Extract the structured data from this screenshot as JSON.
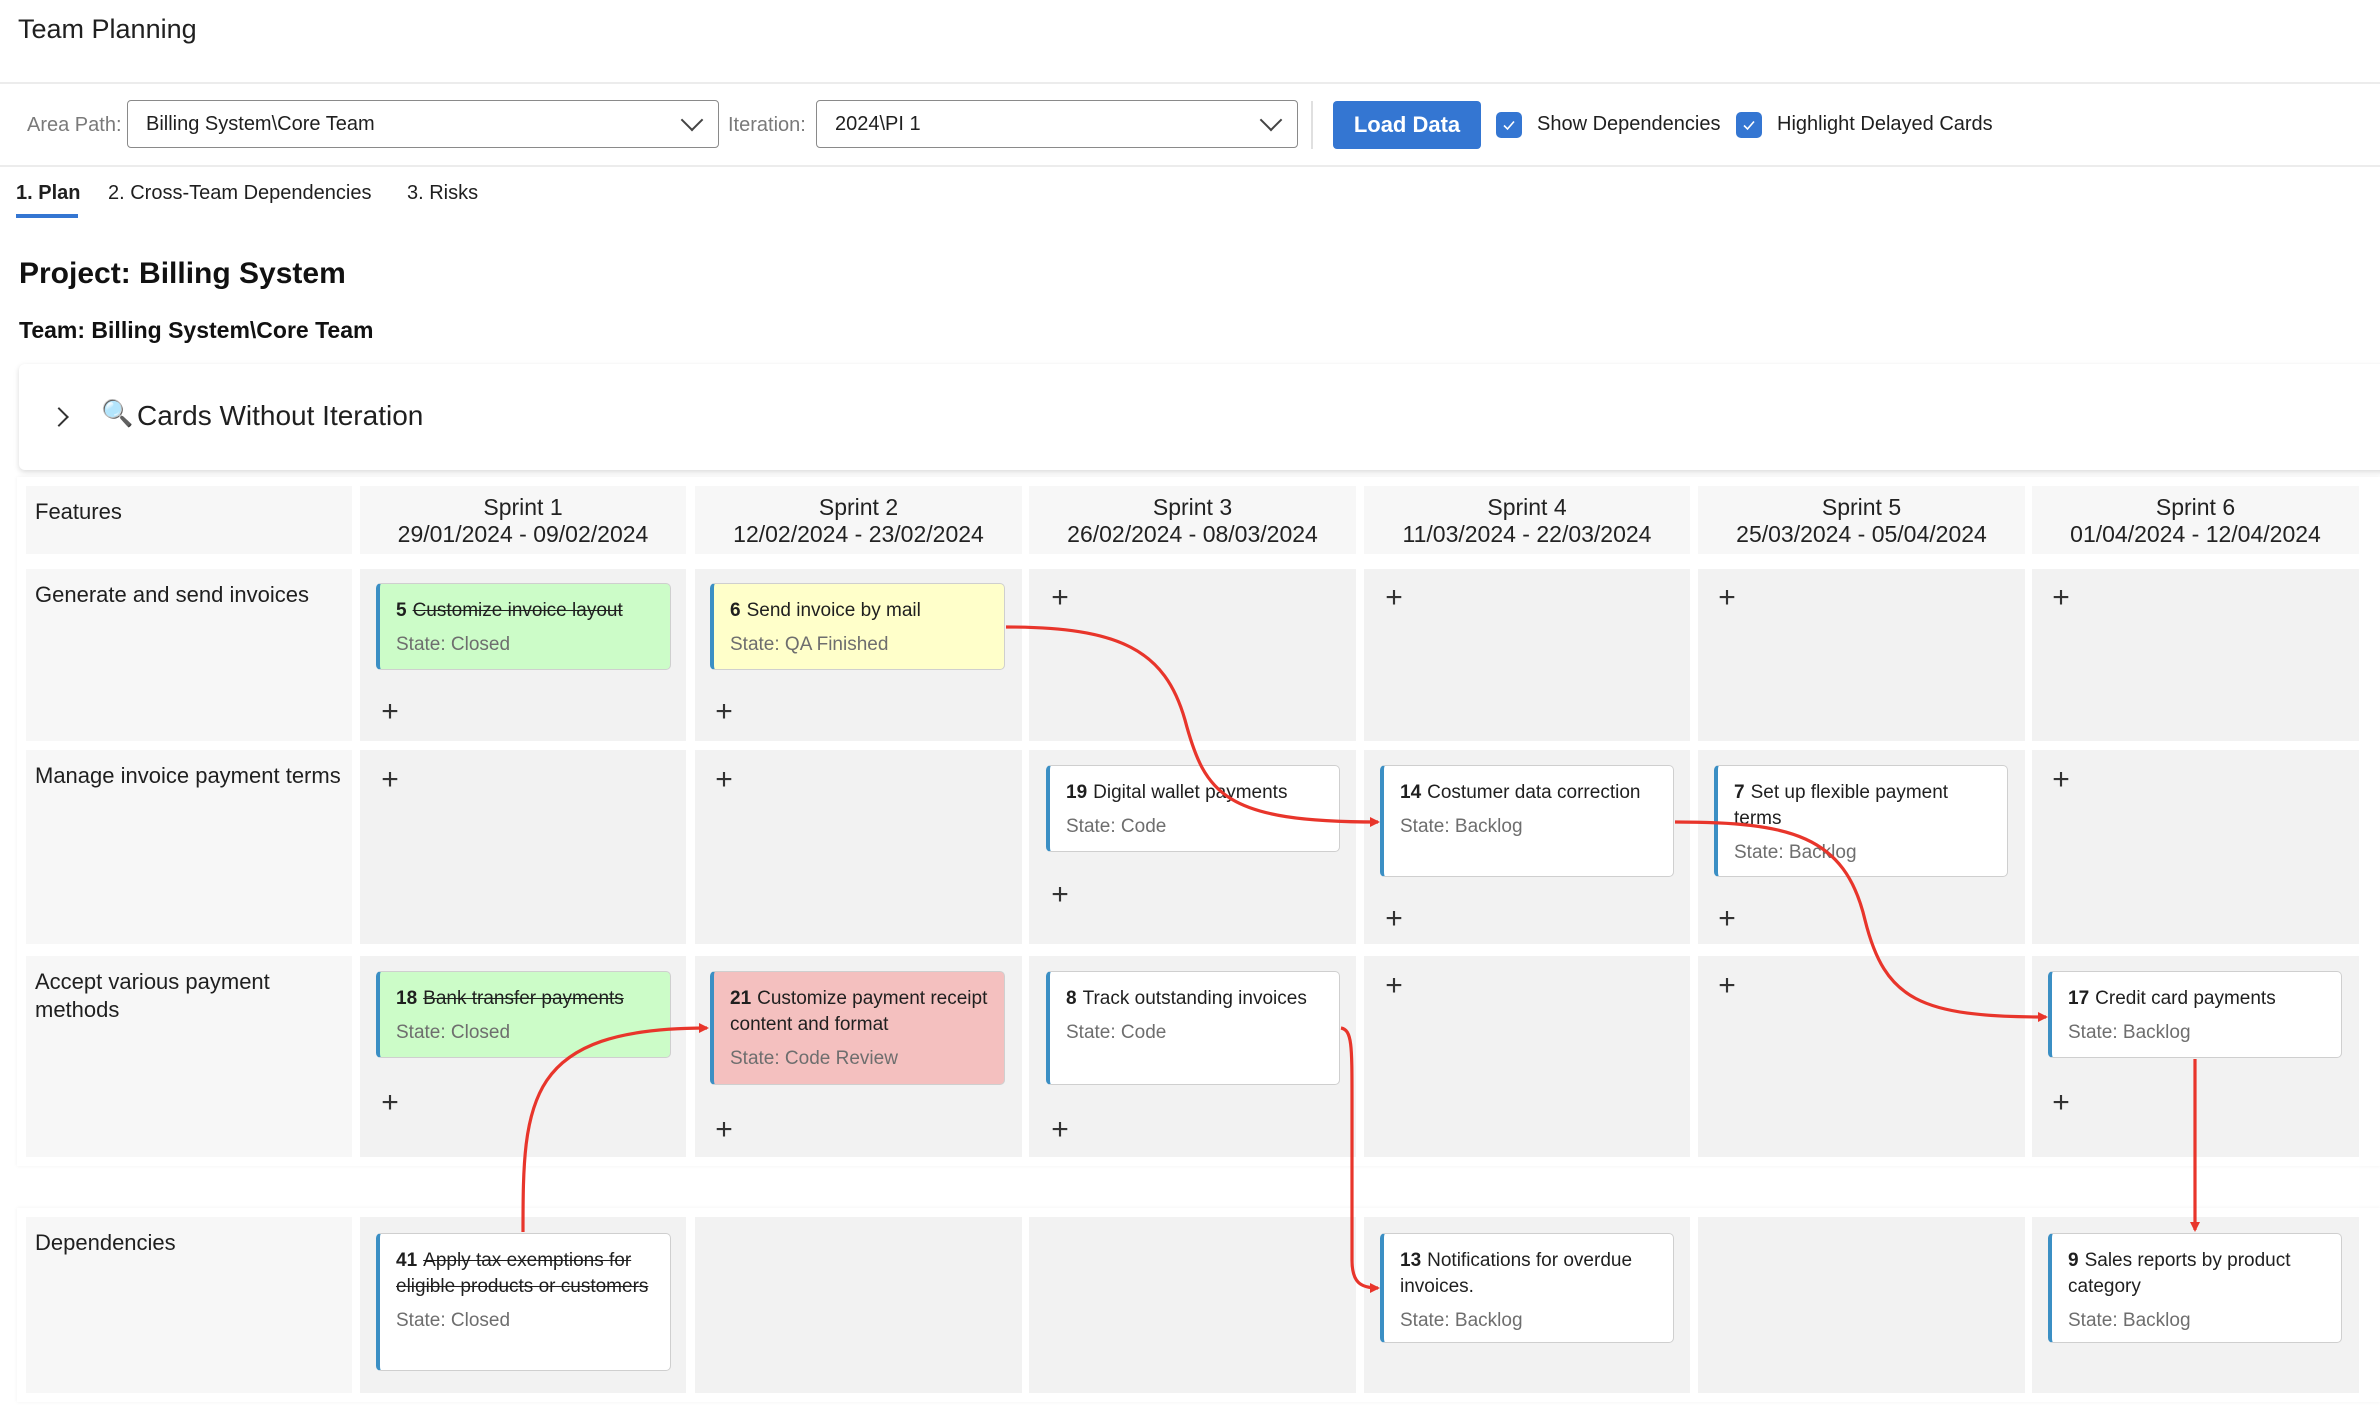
{
  "app": {
    "title": "Team Planning"
  },
  "toolbar": {
    "area_path_label": "Area Path:",
    "area_path_value": "Billing System\\Core Team",
    "iteration_label": "Iteration:",
    "iteration_value": "2024\\PI 1",
    "load_button": "Load Data",
    "show_dependencies": {
      "label": "Show Dependencies",
      "checked": true
    },
    "highlight_delayed": {
      "label": "Highlight Delayed Cards",
      "checked": true
    }
  },
  "tabs": [
    {
      "label": "1. Plan",
      "active": true
    },
    {
      "label": "2. Cross-Team Dependencies",
      "active": false
    },
    {
      "label": "3. Risks",
      "active": false
    }
  ],
  "project_heading": "Project: Billing System",
  "team_heading": "Team: Billing System\\Core Team",
  "cards_without_iteration": {
    "icon": "magnifier-icon",
    "glyph": "🔍",
    "title": "Cards Without Iteration",
    "expanded": false
  },
  "board": {
    "features_header": "Features",
    "sprints": [
      {
        "name": "Sprint 1",
        "dates": "29/01/2024 - 09/02/2024"
      },
      {
        "name": "Sprint 2",
        "dates": "12/02/2024 - 23/02/2024"
      },
      {
        "name": "Sprint 3",
        "dates": "26/02/2024 - 08/03/2024"
      },
      {
        "name": "Sprint 4",
        "dates": "11/03/2024 - 22/03/2024"
      },
      {
        "name": "Sprint 5",
        "dates": "25/03/2024 - 05/04/2024"
      },
      {
        "name": "Sprint 6",
        "dates": "01/04/2024 - 12/04/2024"
      }
    ],
    "rows": [
      {
        "feature": "Generate and send invoices"
      },
      {
        "feature": "Manage invoice payment terms"
      },
      {
        "feature": "Accept various payment methods"
      },
      {
        "feature": "Dependencies"
      }
    ],
    "cards": [
      {
        "id": "5",
        "title": "Customize invoice layout",
        "state": "State: Closed",
        "status": "closed",
        "row": 0,
        "sprint": 0
      },
      {
        "id": "6",
        "title": "Send invoice by mail",
        "state": "State: QA Finished",
        "status": "qa",
        "row": 0,
        "sprint": 1
      },
      {
        "id": "19",
        "title": "Digital wallet payments",
        "state": "State: Code",
        "status": "normal",
        "row": 1,
        "sprint": 2
      },
      {
        "id": "14",
        "title": "Costumer data correction",
        "state": "State: Backlog",
        "status": "normal",
        "row": 1,
        "sprint": 3
      },
      {
        "id": "7",
        "title": "Set up flexible payment terms",
        "state": "State: Backlog",
        "status": "normal",
        "row": 1,
        "sprint": 4
      },
      {
        "id": "18",
        "title": "Bank transfer payments",
        "state": "State: Closed",
        "status": "closed",
        "row": 2,
        "sprint": 0
      },
      {
        "id": "21",
        "title": "Customize payment receipt content and format",
        "state": "State: Code Review",
        "status": "delayed",
        "row": 2,
        "sprint": 1
      },
      {
        "id": "8",
        "title": "Track outstanding invoices",
        "state": "State: Code",
        "status": "normal",
        "row": 2,
        "sprint": 2
      },
      {
        "id": "17",
        "title": "Credit card payments",
        "state": "State: Backlog",
        "status": "normal",
        "row": 2,
        "sprint": 5
      },
      {
        "id": "41",
        "title": "Apply tax exemptions for eligible products or customers",
        "state": "State: Closed",
        "status": "closed-white",
        "row": 3,
        "sprint": 0
      },
      {
        "id": "13",
        "title": "Notifications for overdue invoices.",
        "state": "State: Backlog",
        "status": "normal",
        "row": 3,
        "sprint": 3
      },
      {
        "id": "9",
        "title": "Sales reports by product category",
        "state": "State: Backlog",
        "status": "normal",
        "row": 3,
        "sprint": 5
      }
    ],
    "dependencies": [
      {
        "from": "6",
        "to": "14"
      },
      {
        "from": "14",
        "to": "17"
      },
      {
        "from": "41",
        "to": "21"
      },
      {
        "from": "8",
        "to": "13"
      },
      {
        "from": "17",
        "to": "9"
      }
    ],
    "colors": {
      "closed": "#ccfcc8",
      "qa": "#ffffca",
      "delayed": "#f4c0bf",
      "card_accent": "#3b8fc4",
      "dependency_arrow": "#e8352b",
      "primary": "#3476d2"
    }
  }
}
